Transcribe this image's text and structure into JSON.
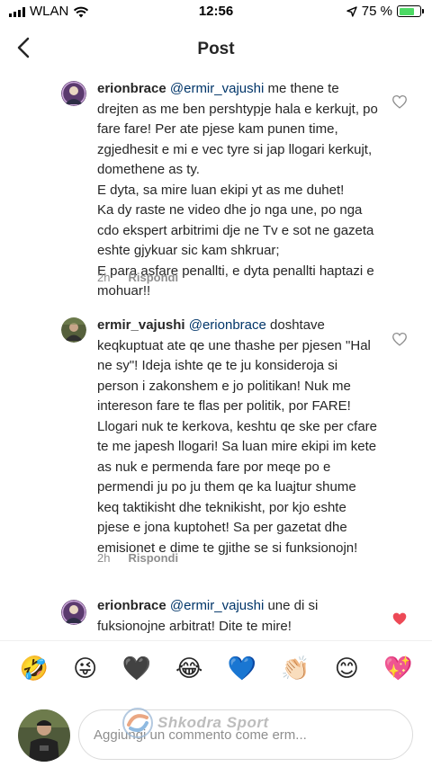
{
  "status_bar": {
    "carrier": "WLAN",
    "time": "12:56",
    "battery_percent": "75 %",
    "battery_level": 0.75
  },
  "nav": {
    "title": "Post",
    "back_icon": "chevron-left-icon"
  },
  "comments": [
    {
      "username": "erionbrace",
      "mention": "@ermir_vajushi",
      "text": "me thene te drejten as me ben pershtypje hala e kerkujt, po fare fare! Per ate pjese kam punen time, zgjedhesit e mi e vec tyre si jap llogari kerkujt, domethene as ty.\nE dyta, sa mire luan ekipi yt as me duhet!\nKa dy raste ne video dhe jo nga une, po nga cdo ekspert arbitrimi dje ne Tv e sot ne gazeta eshte gjykuar sic kam shkruar;\nE para asfare penallti, e dyta penallti haptazi e mohuar!!",
      "time": "2h",
      "reply_label": "Rispondi",
      "liked": false
    },
    {
      "username": "ermir_vajushi",
      "mention": "@erionbrace",
      "text": "doshtave keqkuptuat ate qe une thashe per pjesen \"Hal ne sy\"! Ideja ishte qe te ju konsideroja si person i zakonshem e jo politikan! Nuk me intereson fare te flas per politik, por FARE! Llogari nuk te kerkova, keshtu qe ske per cfare te me japesh llogari! Sa luan mire ekipi im kete as nuk e permenda fare por meqe po e permendi ju po ju them qe ka luajtur shume keq taktikisht dhe teknikisht, por kjo eshte pjese e jona kuptohet! Sa per gazetat dhe emisionet e dime te gjithe se si funksionojn!",
      "time": "2h",
      "reply_label": "Rispondi",
      "liked": false
    },
    {
      "username": "erionbrace",
      "mention": "@ermir_vajushi",
      "text": "une di si fuksionojne arbitrat! Dite te mire!",
      "liked": true
    }
  ],
  "emoji_bar": [
    "🤣",
    "😜",
    "🖤",
    "😂",
    "💙",
    "👏🏻",
    "😊",
    "💖"
  ],
  "comment_input": {
    "placeholder": "Aggiungi un commento come erm..."
  },
  "watermark": {
    "text": "Shkodra Sport"
  },
  "colors": {
    "mention": "#003569",
    "heart_liked": "#ed4956",
    "meta": "#8e8e8e"
  }
}
